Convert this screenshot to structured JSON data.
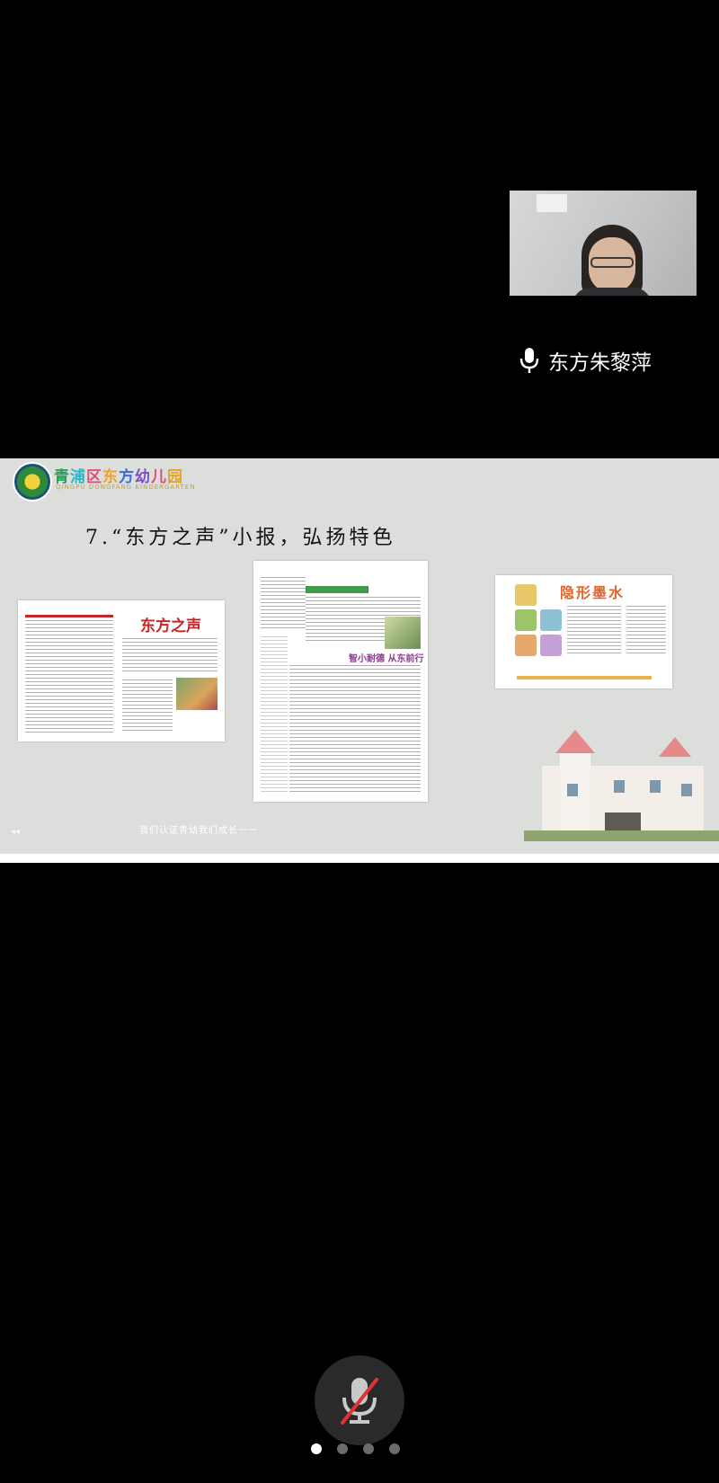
{
  "participant": {
    "name": "东方朱黎萍",
    "mic_state": "on"
  },
  "slide": {
    "school_name_chars": [
      "青",
      "浦",
      "区",
      "东",
      "方",
      "幼",
      "儿",
      "园"
    ],
    "school_subtitle": "QINGPU DONGFANG KINDERGARTEN",
    "title": "7.“东方之声”小报，弘扬特色",
    "paper1": {
      "headline": "东方之声"
    },
    "paper2": {
      "headline": "智小耐德  从东前行"
    },
    "paper3": {
      "headline": "隐形墨水"
    },
    "footer_caption": "我们认证青幼我们成长一一"
  },
  "controls": {
    "mute_button": "mic-muted",
    "pages": {
      "count": 4,
      "active": 1
    }
  },
  "colors": {
    "background": "#000000",
    "slide_background": "#dcdedc",
    "accent_red": "#c6252a",
    "mic_muted_red": "#e0332f"
  }
}
